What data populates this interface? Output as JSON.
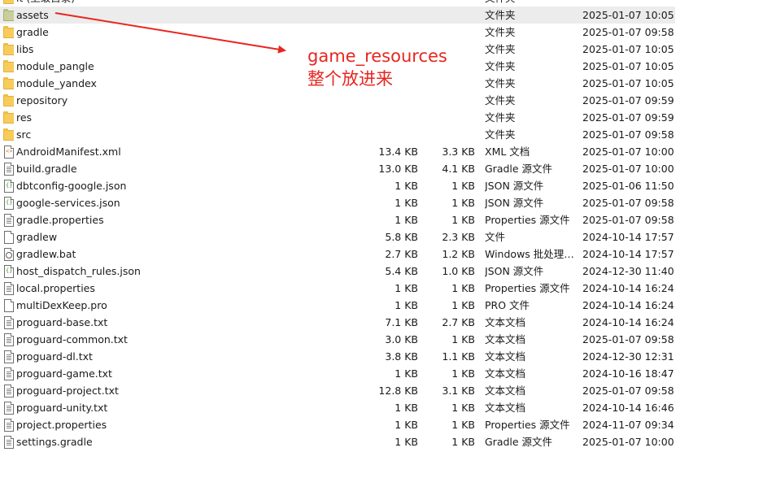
{
  "annotation": {
    "line1": "game_resources",
    "line2": "整个放进来",
    "color": "#e8261f"
  },
  "rows": [
    {
      "name": "lt (上级目录)",
      "size": "",
      "packed": "",
      "type": "文件夹",
      "date": "",
      "icon": "folder"
    },
    {
      "name": "assets",
      "size": "",
      "packed": "",
      "type": "文件夹",
      "date": "2025-01-07 10:05",
      "icon": "folder-greenish",
      "selected": true
    },
    {
      "name": "gradle",
      "size": "",
      "packed": "",
      "type": "文件夹",
      "date": "2025-01-07 09:58",
      "icon": "folder"
    },
    {
      "name": "libs",
      "size": "",
      "packed": "",
      "type": "文件夹",
      "date": "2025-01-07 10:05",
      "icon": "folder"
    },
    {
      "name": "module_pangle",
      "size": "",
      "packed": "",
      "type": "文件夹",
      "date": "2025-01-07 10:05",
      "icon": "folder"
    },
    {
      "name": "module_yandex",
      "size": "",
      "packed": "",
      "type": "文件夹",
      "date": "2025-01-07 10:05",
      "icon": "folder"
    },
    {
      "name": "repository",
      "size": "",
      "packed": "",
      "type": "文件夹",
      "date": "2025-01-07 09:59",
      "icon": "folder"
    },
    {
      "name": "res",
      "size": "",
      "packed": "",
      "type": "文件夹",
      "date": "2025-01-07 09:59",
      "icon": "folder"
    },
    {
      "name": "src",
      "size": "",
      "packed": "",
      "type": "文件夹",
      "date": "2025-01-07 09:58",
      "icon": "folder"
    },
    {
      "name": "AndroidManifest.xml",
      "size": "13.4 KB",
      "packed": "3.3 KB",
      "type": "XML 文档",
      "date": "2025-01-07 10:00",
      "icon": "file-xml"
    },
    {
      "name": "build.gradle",
      "size": "13.0 KB",
      "packed": "4.1 KB",
      "type": "Gradle 源文件",
      "date": "2025-01-07 10:00",
      "icon": "file-text"
    },
    {
      "name": "dbtconfig-google.json",
      "size": "1 KB",
      "packed": "1 KB",
      "type": "JSON 源文件",
      "date": "2025-01-06 11:50",
      "icon": "file-json"
    },
    {
      "name": "google-services.json",
      "size": "1 KB",
      "packed": "1 KB",
      "type": "JSON 源文件",
      "date": "2025-01-07 09:58",
      "icon": "file-json"
    },
    {
      "name": "gradle.properties",
      "size": "1 KB",
      "packed": "1 KB",
      "type": "Properties 源文件",
      "date": "2025-01-07 09:58",
      "icon": "file-text"
    },
    {
      "name": "gradlew",
      "size": "5.8 KB",
      "packed": "2.3 KB",
      "type": "文件",
      "date": "2024-10-14 17:57",
      "icon": "file-blank"
    },
    {
      "name": "gradlew.bat",
      "size": "2.7 KB",
      "packed": "1.2 KB",
      "type": "Windows 批处理…",
      "date": "2024-10-14 17:57",
      "icon": "file-bat"
    },
    {
      "name": "host_dispatch_rules.json",
      "size": "5.4 KB",
      "packed": "1.0 KB",
      "type": "JSON 源文件",
      "date": "2024-12-30 11:40",
      "icon": "file-json"
    },
    {
      "name": "local.properties",
      "size": "1 KB",
      "packed": "1 KB",
      "type": "Properties 源文件",
      "date": "2024-10-14 16:24",
      "icon": "file-text"
    },
    {
      "name": "multiDexKeep.pro",
      "size": "1 KB",
      "packed": "1 KB",
      "type": "PRO 文件",
      "date": "2024-10-14 16:24",
      "icon": "file-blank"
    },
    {
      "name": "proguard-base.txt",
      "size": "7.1 KB",
      "packed": "2.7 KB",
      "type": "文本文档",
      "date": "2024-10-14 16:24",
      "icon": "file-text"
    },
    {
      "name": "proguard-common.txt",
      "size": "3.0 KB",
      "packed": "1 KB",
      "type": "文本文档",
      "date": "2025-01-07 09:58",
      "icon": "file-text"
    },
    {
      "name": "proguard-dl.txt",
      "size": "3.8 KB",
      "packed": "1.1 KB",
      "type": "文本文档",
      "date": "2024-12-30 12:31",
      "icon": "file-text"
    },
    {
      "name": "proguard-game.txt",
      "size": "1 KB",
      "packed": "1 KB",
      "type": "文本文档",
      "date": "2024-10-16 18:47",
      "icon": "file-text"
    },
    {
      "name": "proguard-project.txt",
      "size": "12.8 KB",
      "packed": "3.1 KB",
      "type": "文本文档",
      "date": "2025-01-07 09:58",
      "icon": "file-text"
    },
    {
      "name": "proguard-unity.txt",
      "size": "1 KB",
      "packed": "1 KB",
      "type": "文本文档",
      "date": "2024-10-14 16:46",
      "icon": "file-text"
    },
    {
      "name": "project.properties",
      "size": "1 KB",
      "packed": "1 KB",
      "type": "Properties 源文件",
      "date": "2024-11-07 09:34",
      "icon": "file-text"
    },
    {
      "name": "settings.gradle",
      "size": "1 KB",
      "packed": "1 KB",
      "type": "Gradle 源文件",
      "date": "2025-01-07 10:00",
      "icon": "file-text"
    }
  ]
}
